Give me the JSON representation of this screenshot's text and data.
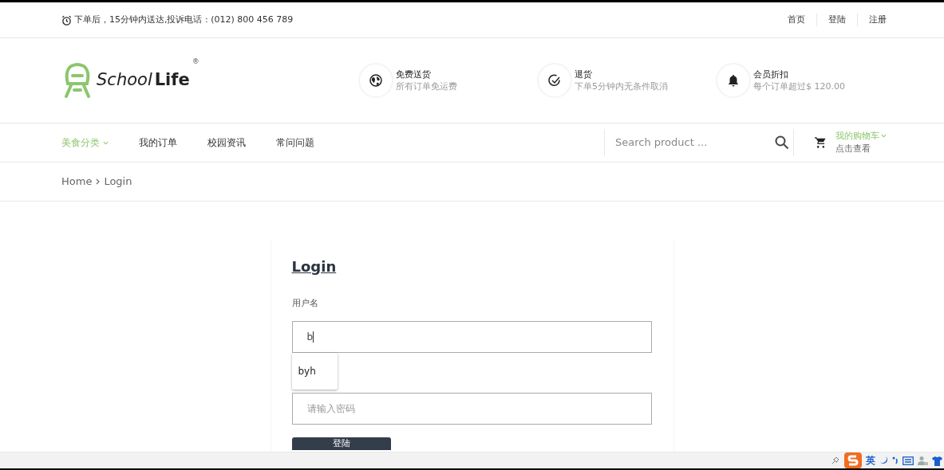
{
  "top_bar": {
    "notice": "下单后，15分钟内送达,投诉电话 : (012) 800 456 789",
    "links": [
      "首页",
      "登陆",
      "注册"
    ]
  },
  "logo": {
    "part_1": "School",
    "part_2": "Life",
    "mark": "®"
  },
  "features": [
    {
      "kind": "globe",
      "title": "免费送货",
      "subtitle": "所有订单免运费"
    },
    {
      "kind": "check",
      "title": "退货",
      "subtitle": "下单5分钟内无条件取消"
    },
    {
      "kind": "bell",
      "title": "会员折扣",
      "subtitle": "每个订单超过$ 120.00"
    }
  ],
  "nav": [
    {
      "label": "美食分类",
      "selected": true,
      "dropdown": true
    },
    {
      "label": "我的订单",
      "selected": false,
      "dropdown": false
    },
    {
      "label": "校园资讯",
      "selected": false,
      "dropdown": false
    },
    {
      "label": "常问问题",
      "selected": false,
      "dropdown": false
    }
  ],
  "search": {
    "placeholder": "Search product ..."
  },
  "cart": {
    "title": "我的购物车",
    "subtitle": "点击查看"
  },
  "breadcrumb": [
    "Home",
    "Login"
  ],
  "form": {
    "title": "Login",
    "username_label": "用户名",
    "username_value": "b",
    "suggestions": [
      "byh"
    ],
    "password_placeholder": "请输入密码",
    "submit": "登陆"
  },
  "ime_bar": {
    "language": "英"
  }
}
